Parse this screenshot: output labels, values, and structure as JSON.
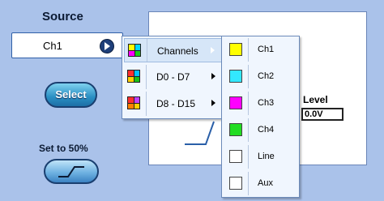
{
  "source": {
    "title": "Source",
    "value": "Ch1"
  },
  "select_button": {
    "label": "Select"
  },
  "set50": {
    "label": "Set to 50%"
  },
  "level": {
    "label": "Level",
    "value": "0.0V"
  },
  "menu_primary": {
    "items": [
      {
        "label": "Channels",
        "icon": "quad-color-icon",
        "colors": [
          "#ffff00",
          "#00d8ff",
          "#ff00ff",
          "#18d018"
        ],
        "selected": true
      },
      {
        "label": "D0 - D7",
        "icon": "quad-color-icon",
        "colors": [
          "#ff3030",
          "#00c0ff",
          "#ffd000",
          "#18c018"
        ],
        "selected": false
      },
      {
        "label": "D8 - D15",
        "icon": "quad-color-icon",
        "colors": [
          "#ff3030",
          "#c040ff",
          "#ff8000",
          "#ffd000"
        ],
        "selected": false
      }
    ]
  },
  "menu_channels": {
    "items": [
      {
        "label": "Ch1",
        "color": "#ffff00"
      },
      {
        "label": "Ch2",
        "color": "#33e8ff"
      },
      {
        "label": "Ch3",
        "color": "#ff00ff"
      },
      {
        "label": "Ch4",
        "color": "#22dd22"
      },
      {
        "label": "Line",
        "color": "#ffffff"
      },
      {
        "label": "Aux",
        "color": "#ffffff"
      }
    ]
  }
}
